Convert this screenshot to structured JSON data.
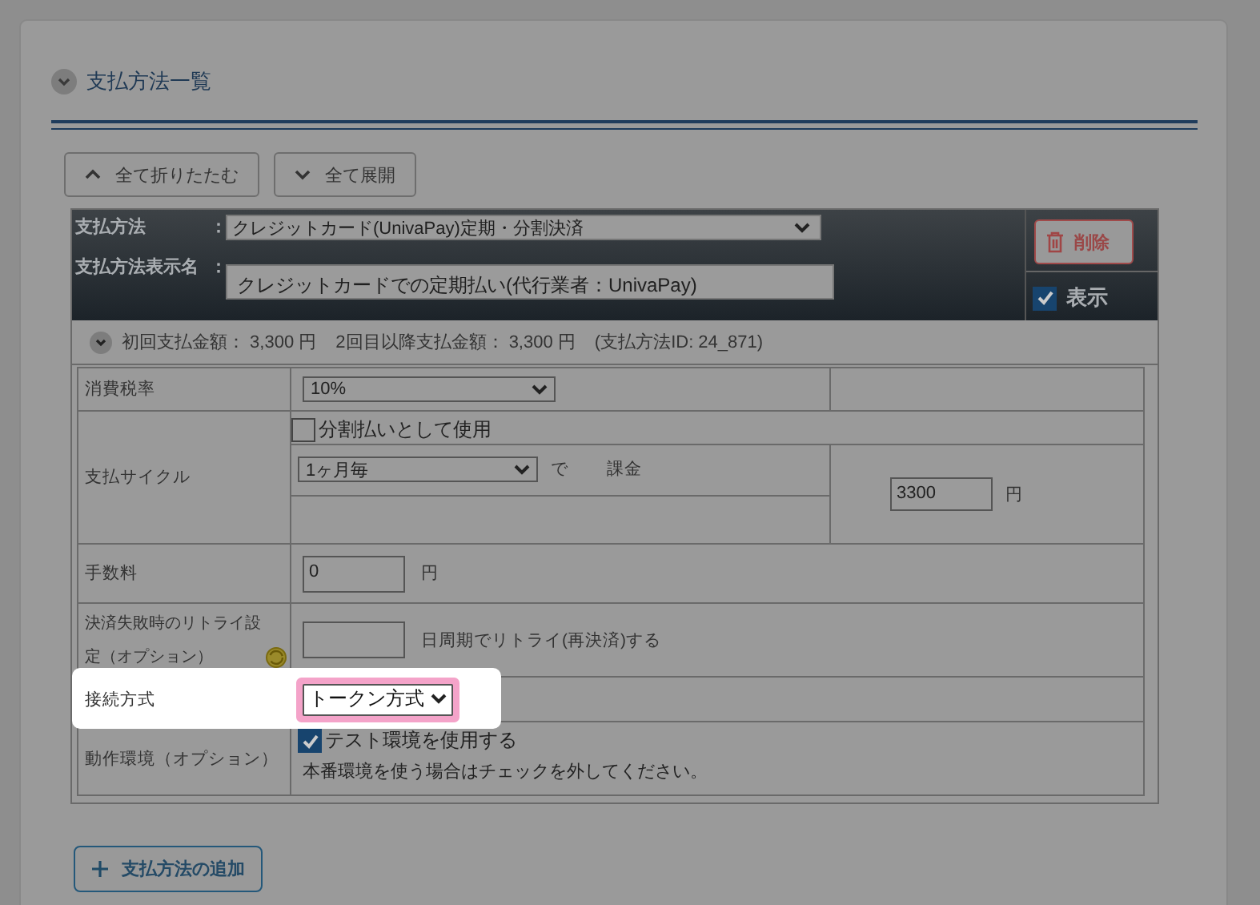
{
  "section": {
    "title": "支払方法一覧",
    "expanded": true
  },
  "toolbar": [
    {
      "label": "全て折りたたむ",
      "kind": "collapse"
    },
    {
      "label": "全て展開",
      "kind": "expand"
    }
  ],
  "payment_method": {
    "method_label": "支払方法",
    "method_separator": "：",
    "method_value": "クレジットカード(UnivaPay)定期・分割決済",
    "display_name_label": "支払方法表示名",
    "display_name_separator": "：",
    "display_name_value": "クレジットカードでの定期払い(代行業者：UnivaPay)",
    "delete_button": "削除",
    "visible": {
      "label": "表示",
      "checked": true
    },
    "summary": {
      "expanded": true,
      "first_payment": "初回支払金額： 3,300 円",
      "later_payment": "2回目以降支払金額： 3,300 円",
      "method_id": "(支払方法ID: 24_871)"
    },
    "settings": {
      "tax": {
        "label": "消費税率",
        "value": "10%"
      },
      "cycle": {
        "label": "支払サイクル",
        "installment": {
          "label": "分割払いとして使用",
          "checked": false
        },
        "period": "1ヶ月毎",
        "unit": "で",
        "charge": "課金",
        "amount": "3300",
        "currency": "円"
      },
      "fee": {
        "label": "手数料",
        "value": "0",
        "currency": "円"
      },
      "retry": {
        "label": "決済失敗時のリトライ設定（オプション）",
        "suffix": "日周期でリトライ(再決済)する"
      },
      "connection": {
        "label": "接続方式",
        "value": "トークン方式",
        "highlighted": true
      },
      "environment": {
        "label": "動作環境（オプション）",
        "test": {
          "label": "テスト環境を使用する",
          "checked": true
        },
        "note": "本番環境を使う場合はチェックを外してください。"
      }
    }
  },
  "add_button": "支払方法の追加"
}
